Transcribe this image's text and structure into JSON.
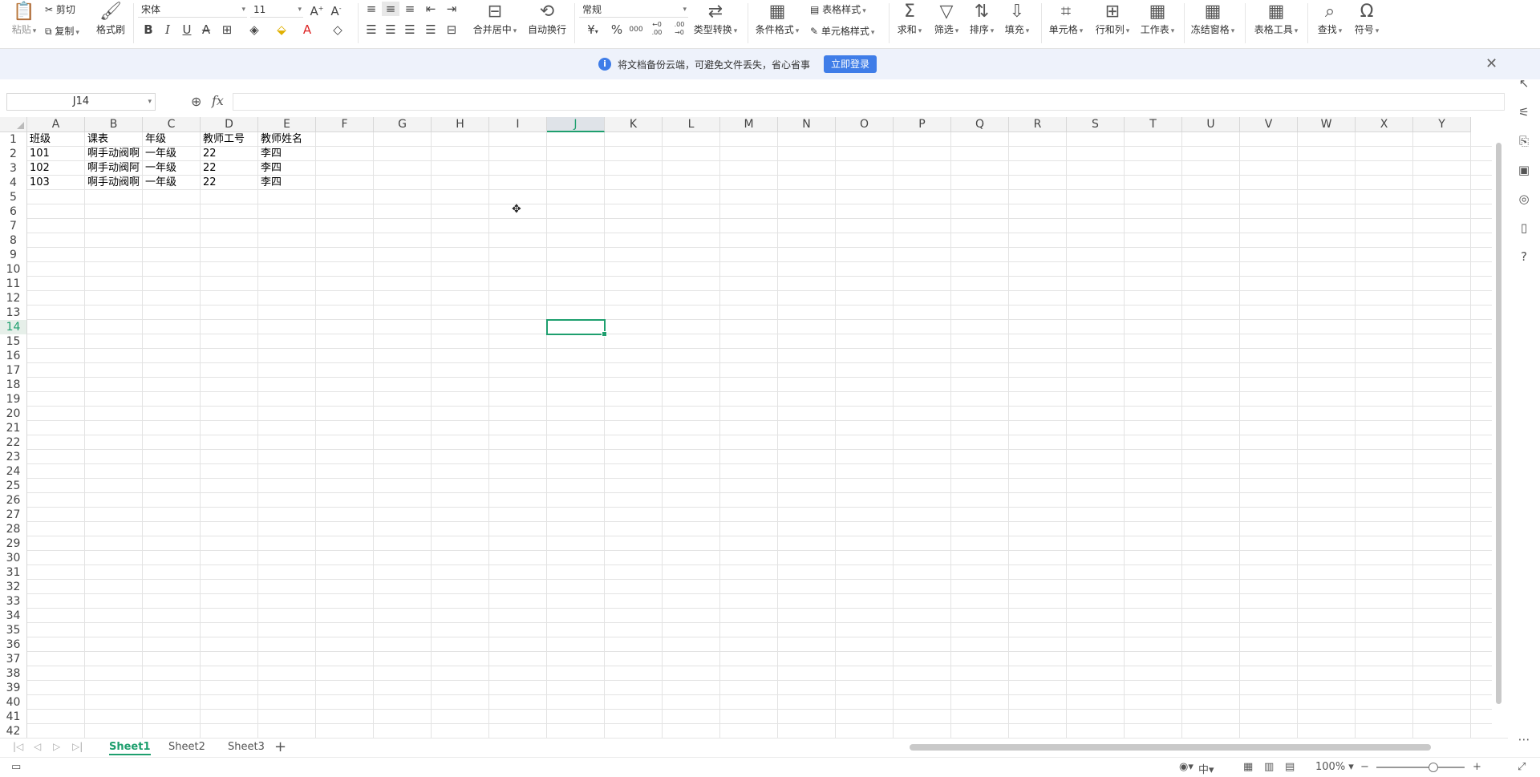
{
  "ribbon": {
    "paste": "粘贴",
    "cut": "剪切",
    "copy": "复制",
    "format_painter": "格式刷",
    "font_name": "宋体",
    "font_size": "11",
    "bold": "B",
    "italic": "I",
    "underline": "U",
    "merge_center": "合并居中",
    "wrap_text": "自动换行",
    "number_format": "常规",
    "type_convert": "类型转换",
    "conditional_format": "条件格式",
    "table_style": "表格样式",
    "cell_style": "单元格样式",
    "sum": "求和",
    "filter": "筛选",
    "sort": "排序",
    "fill": "填充",
    "cell": "单元格",
    "row_col": "行和列",
    "worksheet": "工作表",
    "freeze": "冻结窗格",
    "table_tools": "表格工具",
    "find": "查找",
    "symbol": "符号",
    "currency": "¥",
    "percent": "%",
    "thousands": "000",
    "inc_decimal": "←0 .00",
    "dec_decimal": ".00 →0"
  },
  "notice": {
    "message": "将文档备份云端，可避免文件丢失，省心省事",
    "login_button": "立即登录"
  },
  "formula_bar": {
    "name_box": "J14",
    "fx": "fx",
    "value": ""
  },
  "grid": {
    "columns": [
      "A",
      "B",
      "C",
      "D",
      "E",
      "F",
      "G",
      "H",
      "I",
      "J",
      "K",
      "L",
      "M",
      "N",
      "O",
      "P",
      "Q",
      "R",
      "S",
      "T",
      "U",
      "V",
      "W",
      "X",
      "Y"
    ],
    "selected_column": "J",
    "selected_row": 14,
    "row_count": 42,
    "cells": [
      [
        "班级",
        "课表",
        "年级",
        "教师工号",
        "教师姓名"
      ],
      [
        "101",
        "啊手动阀啊",
        "一年级",
        "22",
        "李四"
      ],
      [
        "102",
        "啊手动阀阿",
        "一年级",
        "22",
        "李四"
      ],
      [
        "103",
        "啊手动阀啊",
        "一年级",
        "22",
        "李四"
      ]
    ]
  },
  "sheets": {
    "tabs": [
      "Sheet1",
      "Sheet2",
      "Sheet3"
    ],
    "active": "Sheet1"
  },
  "status": {
    "zoom": "100%"
  }
}
